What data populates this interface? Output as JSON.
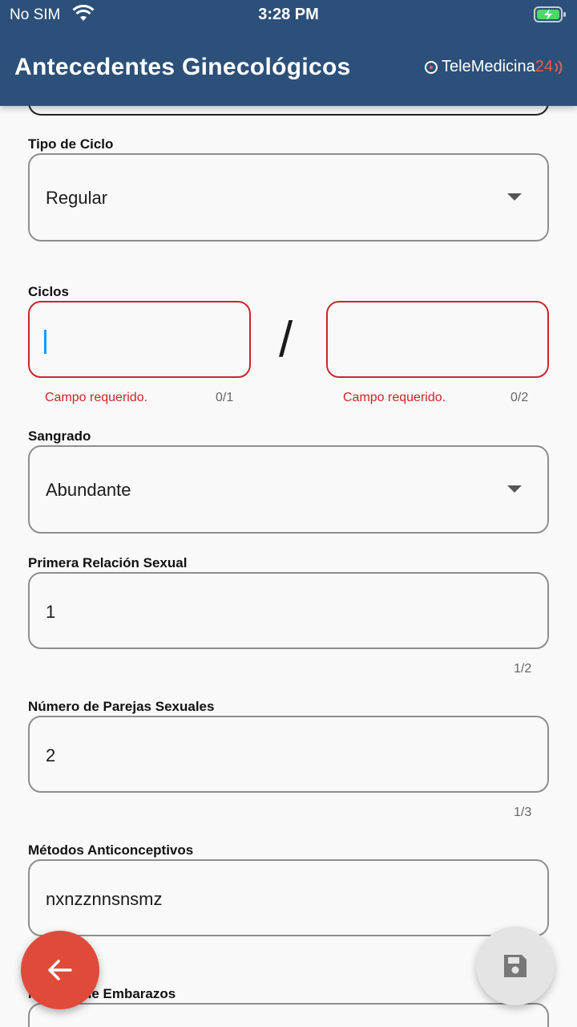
{
  "status_bar": {
    "carrier": "No SIM",
    "time": "3:28 PM"
  },
  "header": {
    "title": "Antecedentes Ginecológicos",
    "logo_text": "TeleMedicina",
    "logo_number": "24"
  },
  "form": {
    "tipo_ciclo": {
      "label": "Tipo de Ciclo",
      "value": "Regular"
    },
    "ciclos": {
      "label": "Ciclos",
      "separator": "/",
      "left": {
        "value": "",
        "error": "Campo requerido.",
        "counter": "0/1"
      },
      "right": {
        "value": "",
        "error": "Campo requerido.",
        "counter": "0/2"
      }
    },
    "sangrado": {
      "label": "Sangrado",
      "value": "Abundante"
    },
    "primera_relacion": {
      "label": "Primera Relación Sexual",
      "value": "1",
      "counter": "1/2"
    },
    "parejas": {
      "label": "Número de Parejas Sexuales",
      "value": "2",
      "counter": "1/3"
    },
    "metodos": {
      "label": "Métodos Anticonceptivos",
      "value": "nxnzznnsnsmz"
    },
    "embarazos": {
      "label": "Número de Embarazos"
    }
  },
  "icons": {
    "back": "arrow-back-icon",
    "save": "save-icon",
    "dropdown": "chevron-down-icon"
  },
  "colors": {
    "header": "#2c5079",
    "error": "#c62828",
    "fab_back": "#e04a3a",
    "fab_save": "#e4e4e4"
  }
}
